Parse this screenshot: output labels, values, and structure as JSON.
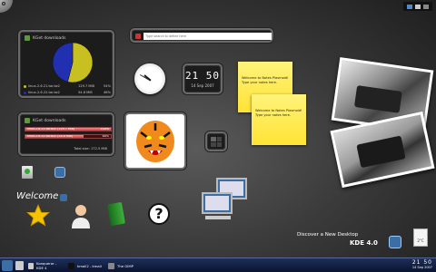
{
  "search": {
    "placeholder": "Type search to define here"
  },
  "kget_pie": {
    "title": "KGet downloads",
    "rows": [
      {
        "name": "linux-2.6.21.tar.bz2",
        "size": "129.7 MiB",
        "pct": "54%",
        "color": "#c8c020"
      },
      {
        "name": "linux-2.6.22.tar.bz2",
        "size": "54.8 MiB",
        "pct": "46%",
        "color": "#2030b0"
      }
    ]
  },
  "chart_data": {
    "type": "pie",
    "categories": [
      "linux-2.6.21.tar.bz2",
      "linux-2.6.22.tar.bz2"
    ],
    "values": [
      54,
      46
    ]
  },
  "kget_bar": {
    "title": "KGet downloads",
    "rows": [
      {
        "name": "linux-2.6.21.tar.bz2 (129.7 MiB)",
        "pct": "100%",
        "fill": 1.0
      },
      {
        "name": "linux-2.6.22.tar.bz2 (54.8 MiB)",
        "pct": "68%",
        "fill": 0.68
      }
    ],
    "total": "Total size: 172.5 MiB"
  },
  "digital_clock": {
    "time": "21 50",
    "date": "14 Sep 2007"
  },
  "notes": [
    {
      "text": "Welcome to Notes Plasmoid! Type your notes here."
    },
    {
      "text": "Welcome to Notes Plasmoid! Type your notes here."
    }
  ],
  "welcome": {
    "label": "Welcome"
  },
  "kde_promo": {
    "tagline": "Discover a New Desktop",
    "version": "KDE 4.0"
  },
  "taskbar": {
    "tasks": [
      {
        "label": "Konqueror - KDE 4"
      },
      {
        "label": "kmail2 - kmail"
      },
      {
        "label": "The GIMP"
      }
    ],
    "clock_time": "21 50",
    "clock_date": "14 Sep 2007",
    "weather_temp": "2°C"
  },
  "colors": {
    "accent": "#3a6ea5",
    "kget_bar": "#d43a3a",
    "note": "#ffe335"
  }
}
